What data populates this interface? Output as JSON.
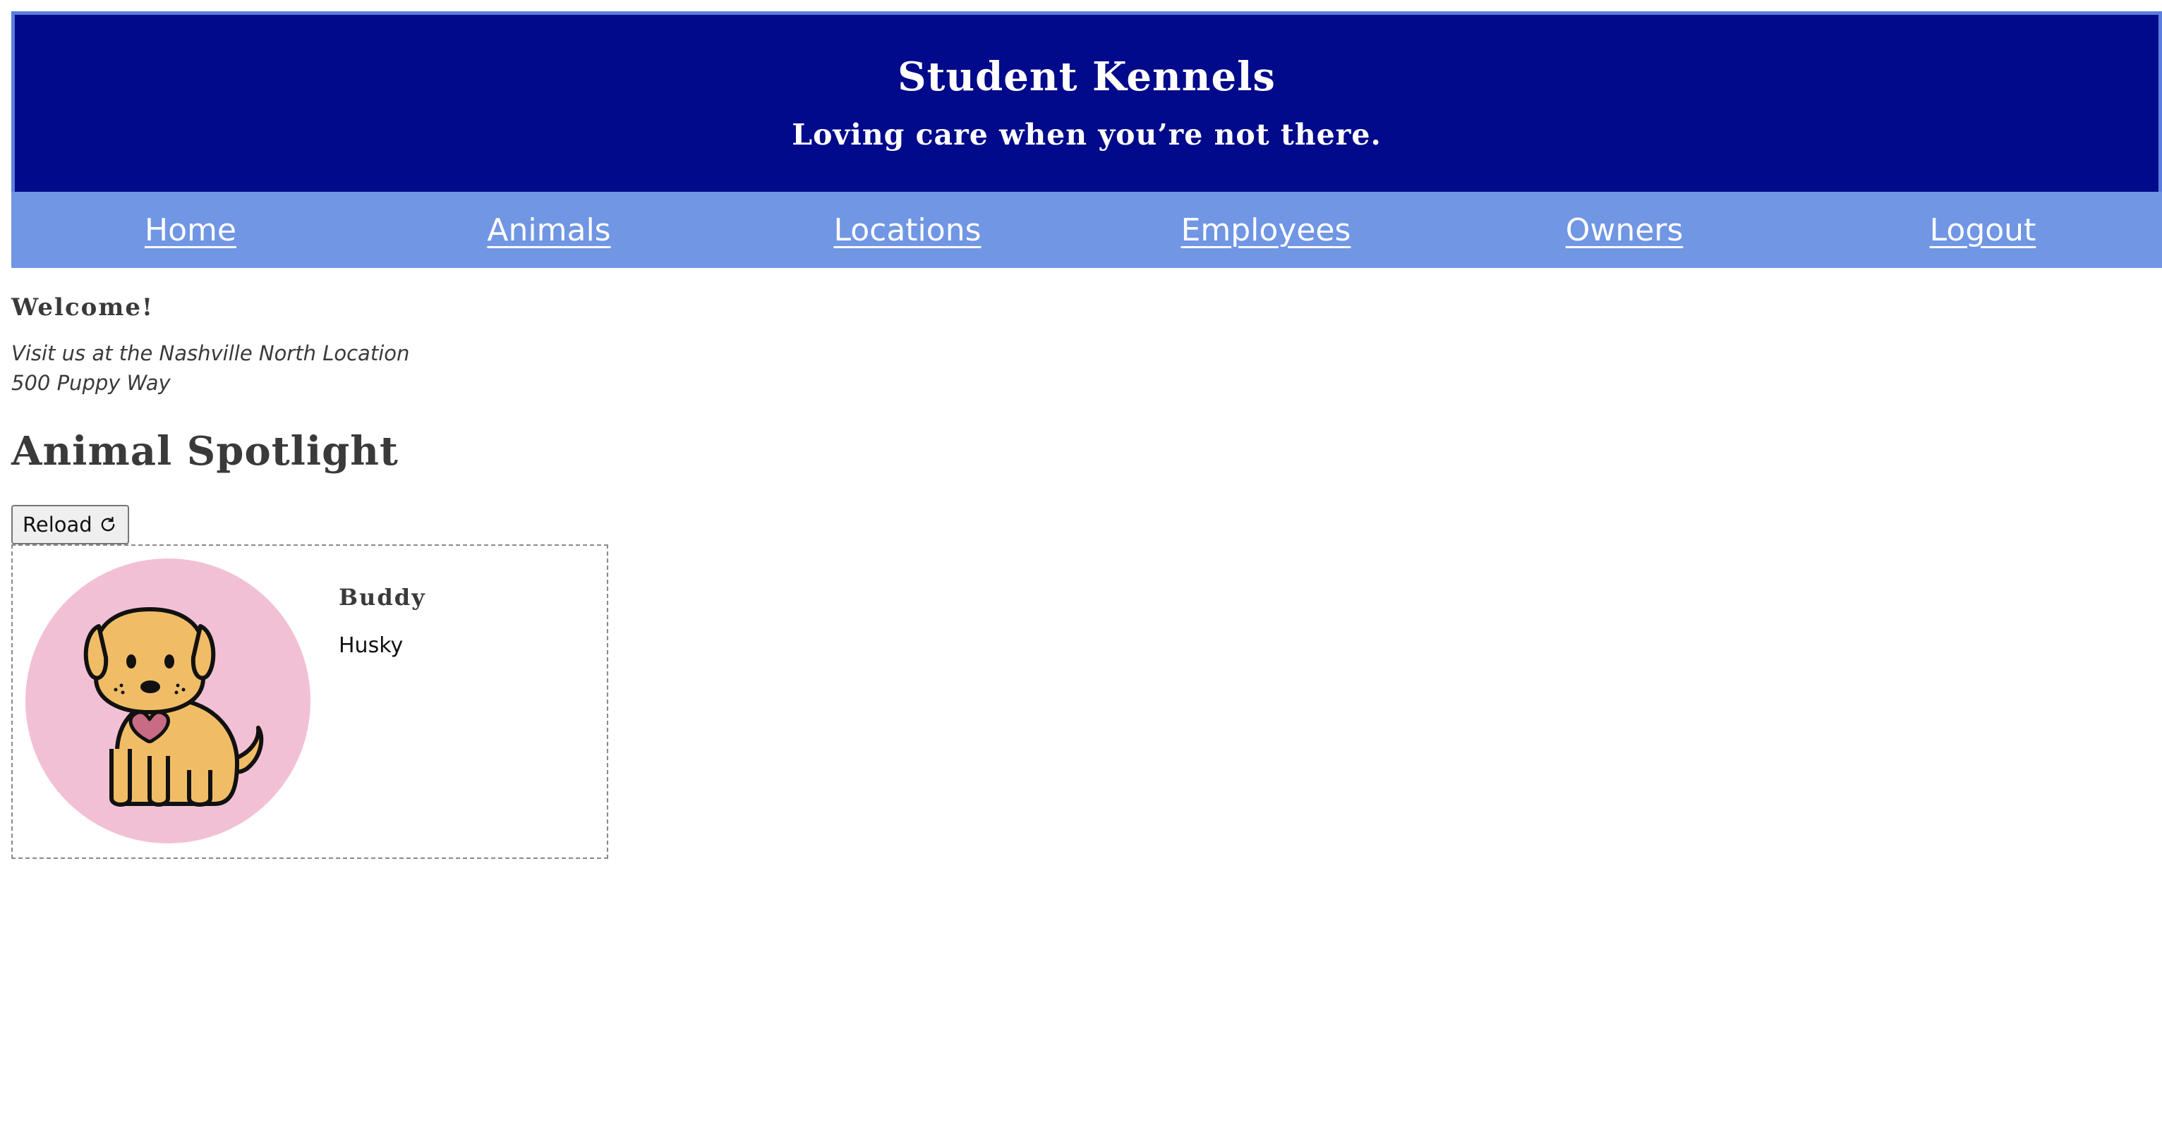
{
  "header": {
    "title": "Student Kennels",
    "tagline": "Loving care when you’re not there."
  },
  "nav": {
    "items": [
      "Home",
      "Animals",
      "Locations",
      "Employees",
      "Owners",
      "Logout"
    ]
  },
  "main": {
    "welcome": "Welcome!",
    "location_line1": "Visit us at the Nashville North Location",
    "location_line2": "500 Puppy Way",
    "spotlight_title": "Animal Spotlight",
    "reload_label": "Reload",
    "reload_icon": "refresh-icon",
    "animal": {
      "name": "Buddy",
      "breed": "Husky",
      "image_icon": "puppy-illustration"
    }
  },
  "colors": {
    "header_bg": "#000a8a",
    "header_border": "#5a7fe0",
    "nav_bg": "#7096e4",
    "avatar_bg": "#f2c0d4",
    "text": "#3a3a3a"
  }
}
